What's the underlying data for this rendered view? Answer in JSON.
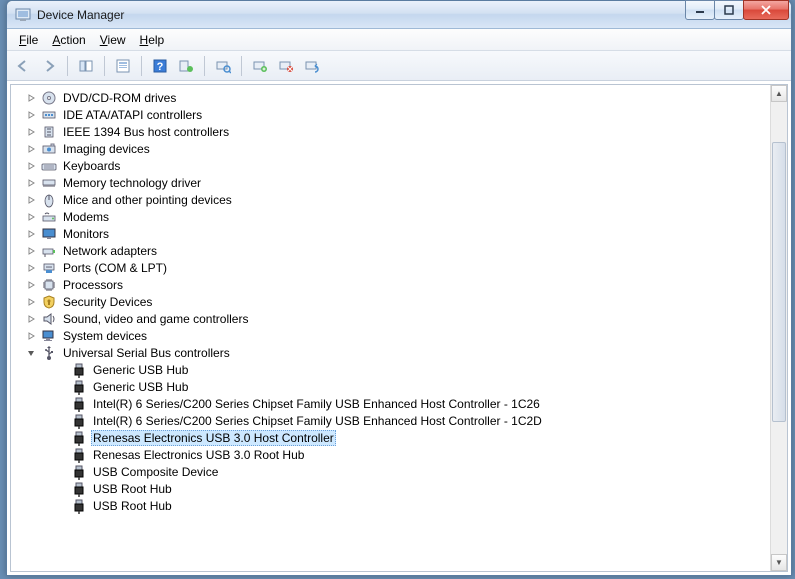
{
  "window": {
    "title": "Device Manager"
  },
  "menu": {
    "file": "File",
    "action": "Action",
    "view": "View",
    "help": "Help"
  },
  "toolbar": {
    "back": "Back",
    "forward": "Forward",
    "show_hide_tree": "Show/Hide Console Tree",
    "properties": "Properties",
    "help": "Help",
    "update": "Update Driver Software",
    "scan": "Scan for hardware changes",
    "uninstall": "Uninstall",
    "disable": "Disable",
    "legacy": "Add legacy hardware"
  },
  "tree": {
    "items": [
      {
        "label": "DVD/CD-ROM drives",
        "icon": "cdrom-icon"
      },
      {
        "label": "IDE ATA/ATAPI controllers",
        "icon": "ide-icon"
      },
      {
        "label": "IEEE 1394 Bus host controllers",
        "icon": "ieee1394-icon"
      },
      {
        "label": "Imaging devices",
        "icon": "imaging-icon"
      },
      {
        "label": "Keyboards",
        "icon": "keyboard-icon"
      },
      {
        "label": "Memory technology driver",
        "icon": "memory-icon"
      },
      {
        "label": "Mice and other pointing devices",
        "icon": "mouse-icon"
      },
      {
        "label": "Modems",
        "icon": "modem-icon"
      },
      {
        "label": "Monitors",
        "icon": "monitor-icon"
      },
      {
        "label": "Network adapters",
        "icon": "network-icon"
      },
      {
        "label": "Ports (COM & LPT)",
        "icon": "port-icon"
      },
      {
        "label": "Processors",
        "icon": "processor-icon"
      },
      {
        "label": "Security Devices",
        "icon": "security-icon"
      },
      {
        "label": "Sound, video and game controllers",
        "icon": "sound-icon"
      },
      {
        "label": "System devices",
        "icon": "system-icon"
      },
      {
        "label": "Universal Serial Bus controllers",
        "icon": "usb-icon",
        "expanded": true
      }
    ],
    "usb_children": [
      {
        "label": "Generic USB Hub"
      },
      {
        "label": "Generic USB Hub"
      },
      {
        "label": "Intel(R) 6 Series/C200 Series Chipset Family USB Enhanced Host Controller - 1C26"
      },
      {
        "label": "Intel(R) 6 Series/C200 Series Chipset Family USB Enhanced Host Controller - 1C2D"
      },
      {
        "label": "Renesas Electronics USB 3.0 Host Controller",
        "selected": true
      },
      {
        "label": "Renesas Electronics USB 3.0 Root Hub"
      },
      {
        "label": "USB Composite Device"
      },
      {
        "label": "USB Root Hub"
      },
      {
        "label": "USB Root Hub"
      }
    ]
  }
}
